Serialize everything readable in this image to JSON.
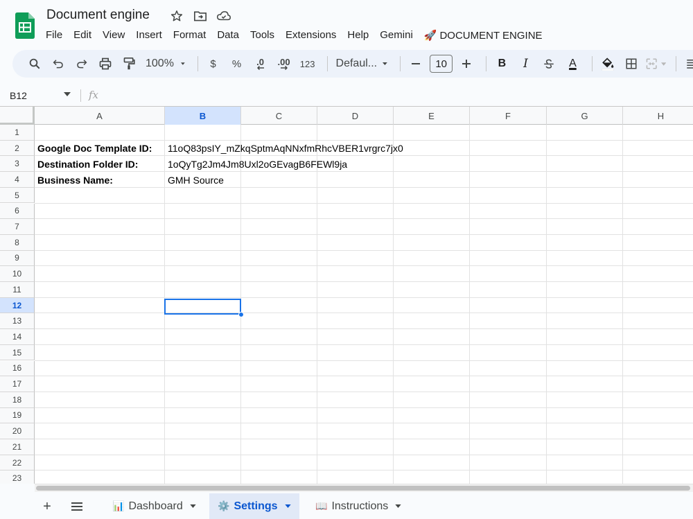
{
  "app": {
    "title": "Document engine"
  },
  "menu": [
    {
      "id": "file",
      "label": "File"
    },
    {
      "id": "edit",
      "label": "Edit"
    },
    {
      "id": "view",
      "label": "View"
    },
    {
      "id": "insert",
      "label": "Insert"
    },
    {
      "id": "format",
      "label": "Format"
    },
    {
      "id": "data",
      "label": "Data"
    },
    {
      "id": "tools",
      "label": "Tools"
    },
    {
      "id": "extensions",
      "label": "Extensions"
    },
    {
      "id": "help",
      "label": "Help"
    },
    {
      "id": "gemini",
      "label": "Gemini"
    },
    {
      "id": "document-engine",
      "label": "DOCUMENT ENGINE",
      "icon": "🚀"
    }
  ],
  "toolbar": {
    "zoom": "100%",
    "currency": "$",
    "percent": "%",
    "decrease_decimal": ".0",
    "increase_decimal": ".00",
    "number_format": "123",
    "font": "Defaul...",
    "font_size": "10",
    "bold": "B",
    "italic": "I",
    "text_color": "A"
  },
  "formula_bar": {
    "name_box": "B12",
    "fx_label": "fx"
  },
  "grid": {
    "columns": [
      "A",
      "B",
      "C",
      "D",
      "E",
      "F",
      "G",
      "H"
    ],
    "rows": [
      "1",
      "2",
      "3",
      "4",
      "5",
      "6",
      "7",
      "8",
      "9",
      "10",
      "11",
      "12",
      "13",
      "14",
      "15",
      "16",
      "17",
      "18",
      "19",
      "20",
      "21",
      "22",
      "23"
    ],
    "active_column": "B",
    "active_row": "12",
    "cells": {
      "A2": "Google Doc Template ID:",
      "B2": "11oQ83psIY_mZkqSptmAqNNxfmRhcVBER1vrgrc7jx0",
      "A3": "Destination Folder ID:",
      "B3": "1oQyTg2Jm4Jm8Uxl2oGEvagB6FEWl9ja",
      "A4": "Business Name:",
      "B4": "GMH Source"
    }
  },
  "sheets": [
    {
      "id": "dashboard",
      "label": "Dashboard",
      "icon": "📊",
      "active": false
    },
    {
      "id": "settings",
      "label": "Settings",
      "icon": "⚙️",
      "active": true
    },
    {
      "id": "instructions",
      "label": "Instructions",
      "icon": "📖",
      "active": false
    }
  ],
  "colors": {
    "accent": "#0b57d0",
    "selection": "#1a73e8",
    "logo": "#0f9d58"
  }
}
